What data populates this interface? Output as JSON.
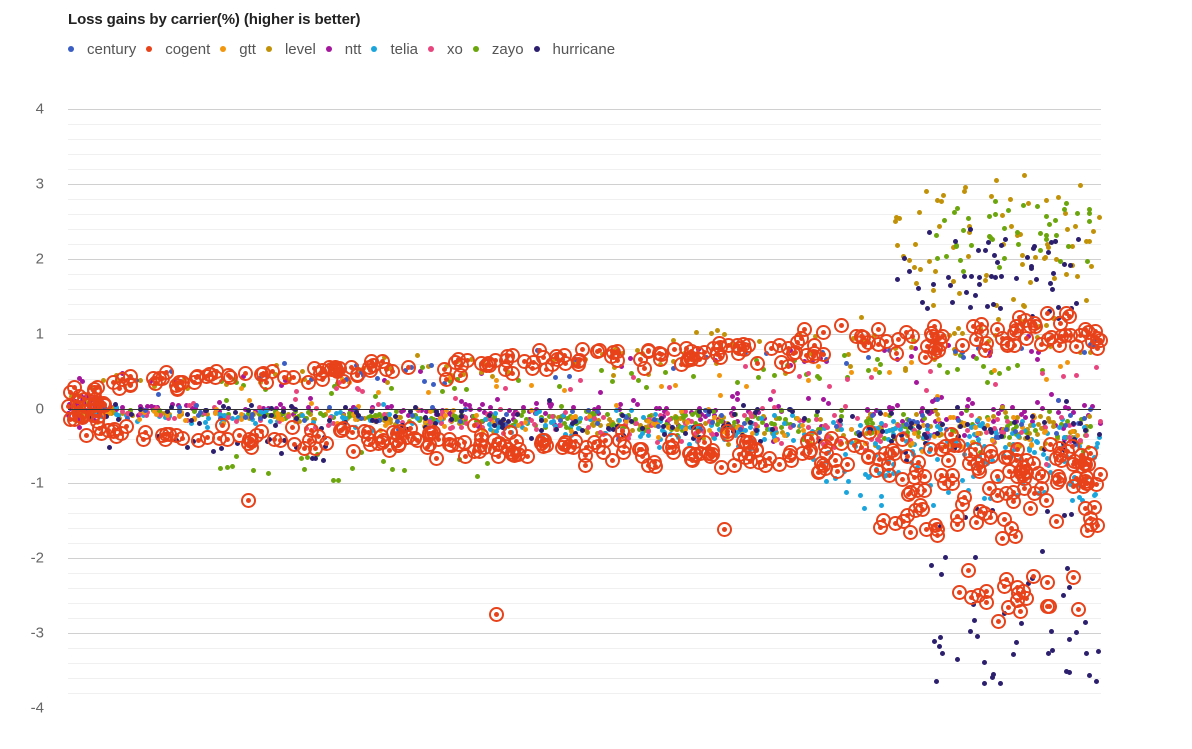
{
  "chart_data": {
    "type": "scatter",
    "title": "Loss gains by carrier(%) (higher is better)",
    "xlabel": "",
    "ylabel": "",
    "ylim": [
      -4.25,
      4.25
    ],
    "xlim": [
      0,
      1000
    ],
    "grid": true,
    "grid_major_step": 1,
    "grid_minor_step": 0.2,
    "legend_position": "top",
    "y_ticks": [
      "4",
      "3",
      "2",
      "1",
      "0",
      "-1",
      "-2",
      "-3",
      "-4"
    ],
    "y_tick_values": [
      4,
      3,
      2,
      1,
      0,
      -1,
      -2,
      -3,
      -4
    ],
    "zero_line": 0,
    "series": [
      {
        "name": "century",
        "color": "#3b5ec4",
        "marker": "dot",
        "point_count": 120,
        "y_range": [
          -1.0,
          0.9
        ],
        "description": "blue dots, mostly between -0.3 and 0.8, rising toward the right"
      },
      {
        "name": "cogent",
        "color": "#e8421a",
        "marker": "ring",
        "point_count": 560,
        "y_range": [
          -2.75,
          1.25
        ],
        "description": "orange-red target/ring markers, two bands: one near +0.4 to +1.2 and a dense one near -0.3 to -1.0, with deep outliers near -2.2 and -2.75"
      },
      {
        "name": "gtt",
        "color": "#f2960d",
        "marker": "dot",
        "point_count": 150,
        "y_range": [
          -1.4,
          0.8
        ],
        "description": "bright orange dots scattered near zero trending slightly negative"
      },
      {
        "name": "level",
        "color": "#c19208",
        "marker": "dot",
        "point_count": 430,
        "y_range": [
          -1.5,
          3.3
        ],
        "description": "dark goldenrod dots, broad band near zero plus a strong rise to +1.5 to +3.3 at the right"
      },
      {
        "name": "ntt",
        "color": "#a4179c",
        "marker": "dot",
        "point_count": 240,
        "y_range": [
          -1.0,
          1.0
        ],
        "description": "magenta-purple dots clustered around zero, denser at the left origin"
      },
      {
        "name": "telia",
        "color": "#1aa5dd",
        "marker": "dot",
        "point_count": 300,
        "y_range": [
          -1.5,
          0.7
        ],
        "description": "cyan dots forming a descending band toward -0.5 to -1.2 on the right"
      },
      {
        "name": "xo",
        "color": "#e8457e",
        "marker": "dot",
        "point_count": 200,
        "y_range": [
          -1.1,
          0.6
        ],
        "description": "pink-rose dots near zero, slight negative drift"
      },
      {
        "name": "zayo",
        "color": "#6aa60c",
        "marker": "dot",
        "point_count": 330,
        "y_range": [
          -1.2,
          2.7
        ],
        "description": "yellow-green dots near zero with a high cluster near +2.2 on the right"
      },
      {
        "name": "hurricane",
        "color": "#2b1f6e",
        "marker": "dot",
        "point_count": 270,
        "y_range": [
          -3.8,
          2.3
        ],
        "description": "dark navy dots near zero with a high cluster near +2 and a long negative tail to -3.8 at the right"
      }
    ]
  },
  "legend": {
    "items": [
      {
        "label": "century",
        "color": "#3b5ec4"
      },
      {
        "label": "cogent",
        "color": "#e8421a"
      },
      {
        "label": "gtt",
        "color": "#f2960d"
      },
      {
        "label": "level",
        "color": "#c19208"
      },
      {
        "label": "ntt",
        "color": "#a4179c"
      },
      {
        "label": "telia",
        "color": "#1aa5dd"
      },
      {
        "label": "xo",
        "color": "#e8457e"
      },
      {
        "label": "zayo",
        "color": "#6aa60c"
      },
      {
        "label": "hurricane",
        "color": "#2b1f6e"
      }
    ]
  }
}
